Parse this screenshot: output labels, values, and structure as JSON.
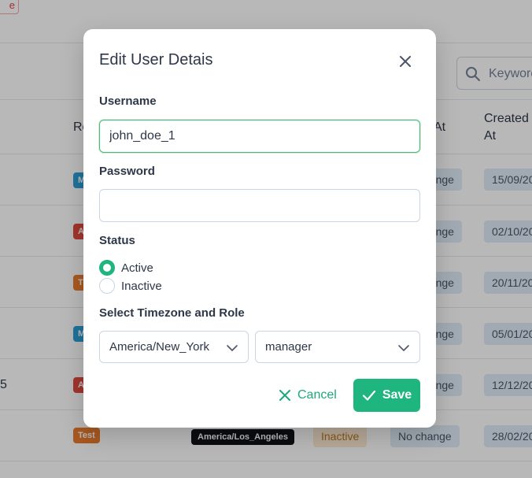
{
  "background": {
    "top_button_label": "e",
    "search": {
      "placeholder": "Keyword"
    },
    "columns": {
      "role": "Ro",
      "updated_at": "At",
      "created_at_line1": "Created",
      "created_at_line2": "At"
    },
    "rows": [
      {
        "role_tag": "M",
        "role_color": "#2b9fd8",
        "change": "change",
        "created": "15/09/20"
      },
      {
        "role_tag": "A",
        "role_color": "#e04a3f",
        "change": "change",
        "created": "02/10/20"
      },
      {
        "role_tag": "T",
        "role_color": "#ea7b2c",
        "change": "change",
        "created": "20/11/20"
      },
      {
        "role_tag": "M",
        "role_color": "#2b9fd8",
        "change": "change",
        "created": "05/01/20"
      },
      {
        "left_num": "5",
        "role_tag": "A",
        "role_color": "#e04a3f",
        "change": "change",
        "created": "12/12/20"
      },
      {
        "role_tag": "Test",
        "role_color": "#ea7b2c",
        "timezone": "America/Los_Angeles",
        "status": "Inactive",
        "change": "No change",
        "created": "28/02/20"
      }
    ]
  },
  "modal": {
    "title": "Edit User Detais",
    "username": {
      "label": "Username",
      "value": "john_doe_1"
    },
    "password": {
      "label": "Password",
      "value": ""
    },
    "status": {
      "label": "Status",
      "options": [
        "Active",
        "Inactive"
      ],
      "selected": "Active"
    },
    "tz_role": {
      "label": "Select Timezone and Role",
      "timezone": "America/New_York",
      "role": "manager"
    },
    "cancel_label": "Cancel",
    "save_label": "Save"
  },
  "colors": {
    "accent": "#1fb57f",
    "overlay": "rgba(0,0,0,0.28)"
  }
}
